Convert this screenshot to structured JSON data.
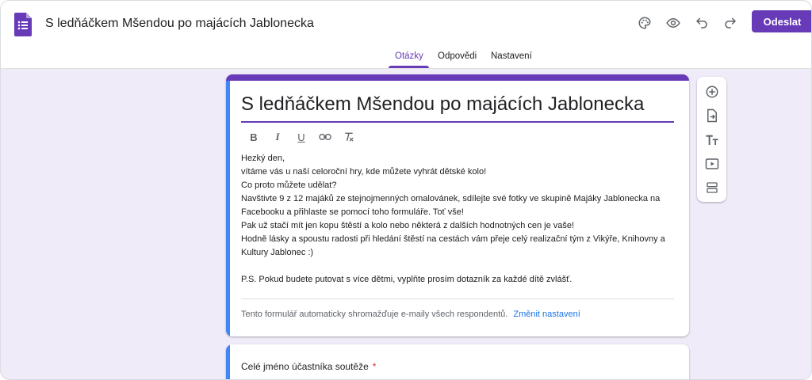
{
  "header": {
    "doc_title": "S ledňáčkem Mšendou po majácích Jablonecka",
    "app_icon": "google-forms-icon",
    "action_icons": [
      "palette-icon",
      "eye-icon",
      "undo-icon",
      "redo-icon"
    ],
    "send_label": "Odeslat"
  },
  "tabs": [
    {
      "label": "Otázky",
      "active": true
    },
    {
      "label": "Odpovědi",
      "active": false
    },
    {
      "label": "Nastavení",
      "active": false
    }
  ],
  "form": {
    "title": "S ledňáčkem Mšendou po majácích Jablonecka",
    "format_buttons": [
      "bold-icon",
      "italic-icon",
      "underline-icon",
      "link-icon",
      "clear-format-icon"
    ],
    "description_lines": [
      "Hezký den,",
      "vítáme vás u naší celoroční hry, kde můžete vyhrát dětské kolo!",
      "Co proto můžete udělat?",
      "Navštivte 9 z 12 majáků ze stejnojmenných omalovánek, sdílejte své fotky ve skupině Majáky Jablonecka na",
      "Facebooku a přihlaste se pomocí toho formuláře. Toť vše!",
      "Pak už stačí mít jen kopu štěstí a kolo nebo některá z dalších hodnotných cen je vaše!",
      "Hodně lásky a spoustu radosti při hledání štěstí na cestách vám přeje celý realizační tým z Vikýře, Knihovny a",
      "Kultury Jablonec :)",
      "",
      "P.S. Pokud budete putovat s více dětmi, vyplňte prosím dotazník za každé dítě zvlášť."
    ],
    "email_note": "Tento formulář automaticky shromažďuje e-maily všech respondentů.",
    "email_link": "Změnit nastavení"
  },
  "side_toolbar": [
    "add-question-icon",
    "import-questions-icon",
    "add-title-icon",
    "add-video-icon",
    "add-section-icon"
  ],
  "question": {
    "title": "Celé jméno účastníka soutěže",
    "required_mark": "*"
  },
  "colors": {
    "accent": "#673ab7",
    "background": "#f0ebf8",
    "active_strip": "#4285f4",
    "link": "#1a73e8",
    "required": "#d93025"
  }
}
